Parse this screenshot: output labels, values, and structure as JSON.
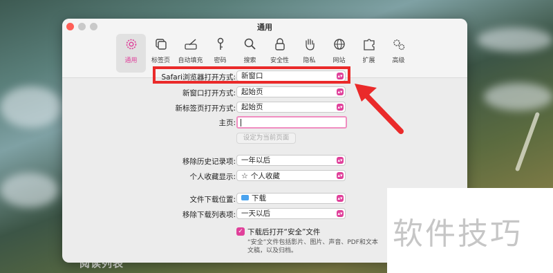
{
  "window": {
    "title": "通用"
  },
  "toolbar": {
    "items": [
      {
        "label": "通用",
        "icon": "gear-icon",
        "active": true
      },
      {
        "label": "标签页",
        "icon": "tabs-icon"
      },
      {
        "label": "自动填充",
        "icon": "pencil-icon"
      },
      {
        "label": "密码",
        "icon": "key-icon"
      },
      {
        "label": "搜索",
        "icon": "search-icon"
      },
      {
        "label": "安全性",
        "icon": "lock-icon"
      },
      {
        "label": "隐私",
        "icon": "hand-icon"
      },
      {
        "label": "网站",
        "icon": "globe-icon"
      },
      {
        "label": "扩展",
        "icon": "puzzle-icon"
      },
      {
        "label": "高级",
        "icon": "gears-icon"
      }
    ]
  },
  "settings": {
    "safari_opens_with": {
      "label": "Safari浏览器打开方式:",
      "value": "新窗口"
    },
    "new_windows_open_with": {
      "label": "新窗口打开方式:",
      "value": "起始页"
    },
    "new_tabs_open_with": {
      "label": "新标签页打开方式:",
      "value": "起始页"
    },
    "homepage": {
      "label": "主页:",
      "value": ""
    },
    "set_current_page": {
      "label": "设定为当前页面"
    },
    "remove_history": {
      "label": "移除历史记录项:",
      "value": "一年以后"
    },
    "favorites_shows": {
      "label": "个人收藏显示:",
      "value": "个人收藏"
    },
    "download_location": {
      "label": "文件下载位置:",
      "value": "下载"
    },
    "remove_download_items": {
      "label": "移除下载列表项:",
      "value": "一天以后"
    },
    "open_safe_files": {
      "label": "下载后打开“安全”文件",
      "checked": true
    },
    "safe_files_note_line1": "“安全”文件包括影片、图片、声音、PDF和文本",
    "safe_files_note_line2": "文稿，以及归档。"
  },
  "background": {
    "bottom_text": "阅读列表"
  },
  "watermark": {
    "text": "软件技巧"
  },
  "colors": {
    "accent": "#e0409a",
    "annotation": "#ea2a2a"
  }
}
